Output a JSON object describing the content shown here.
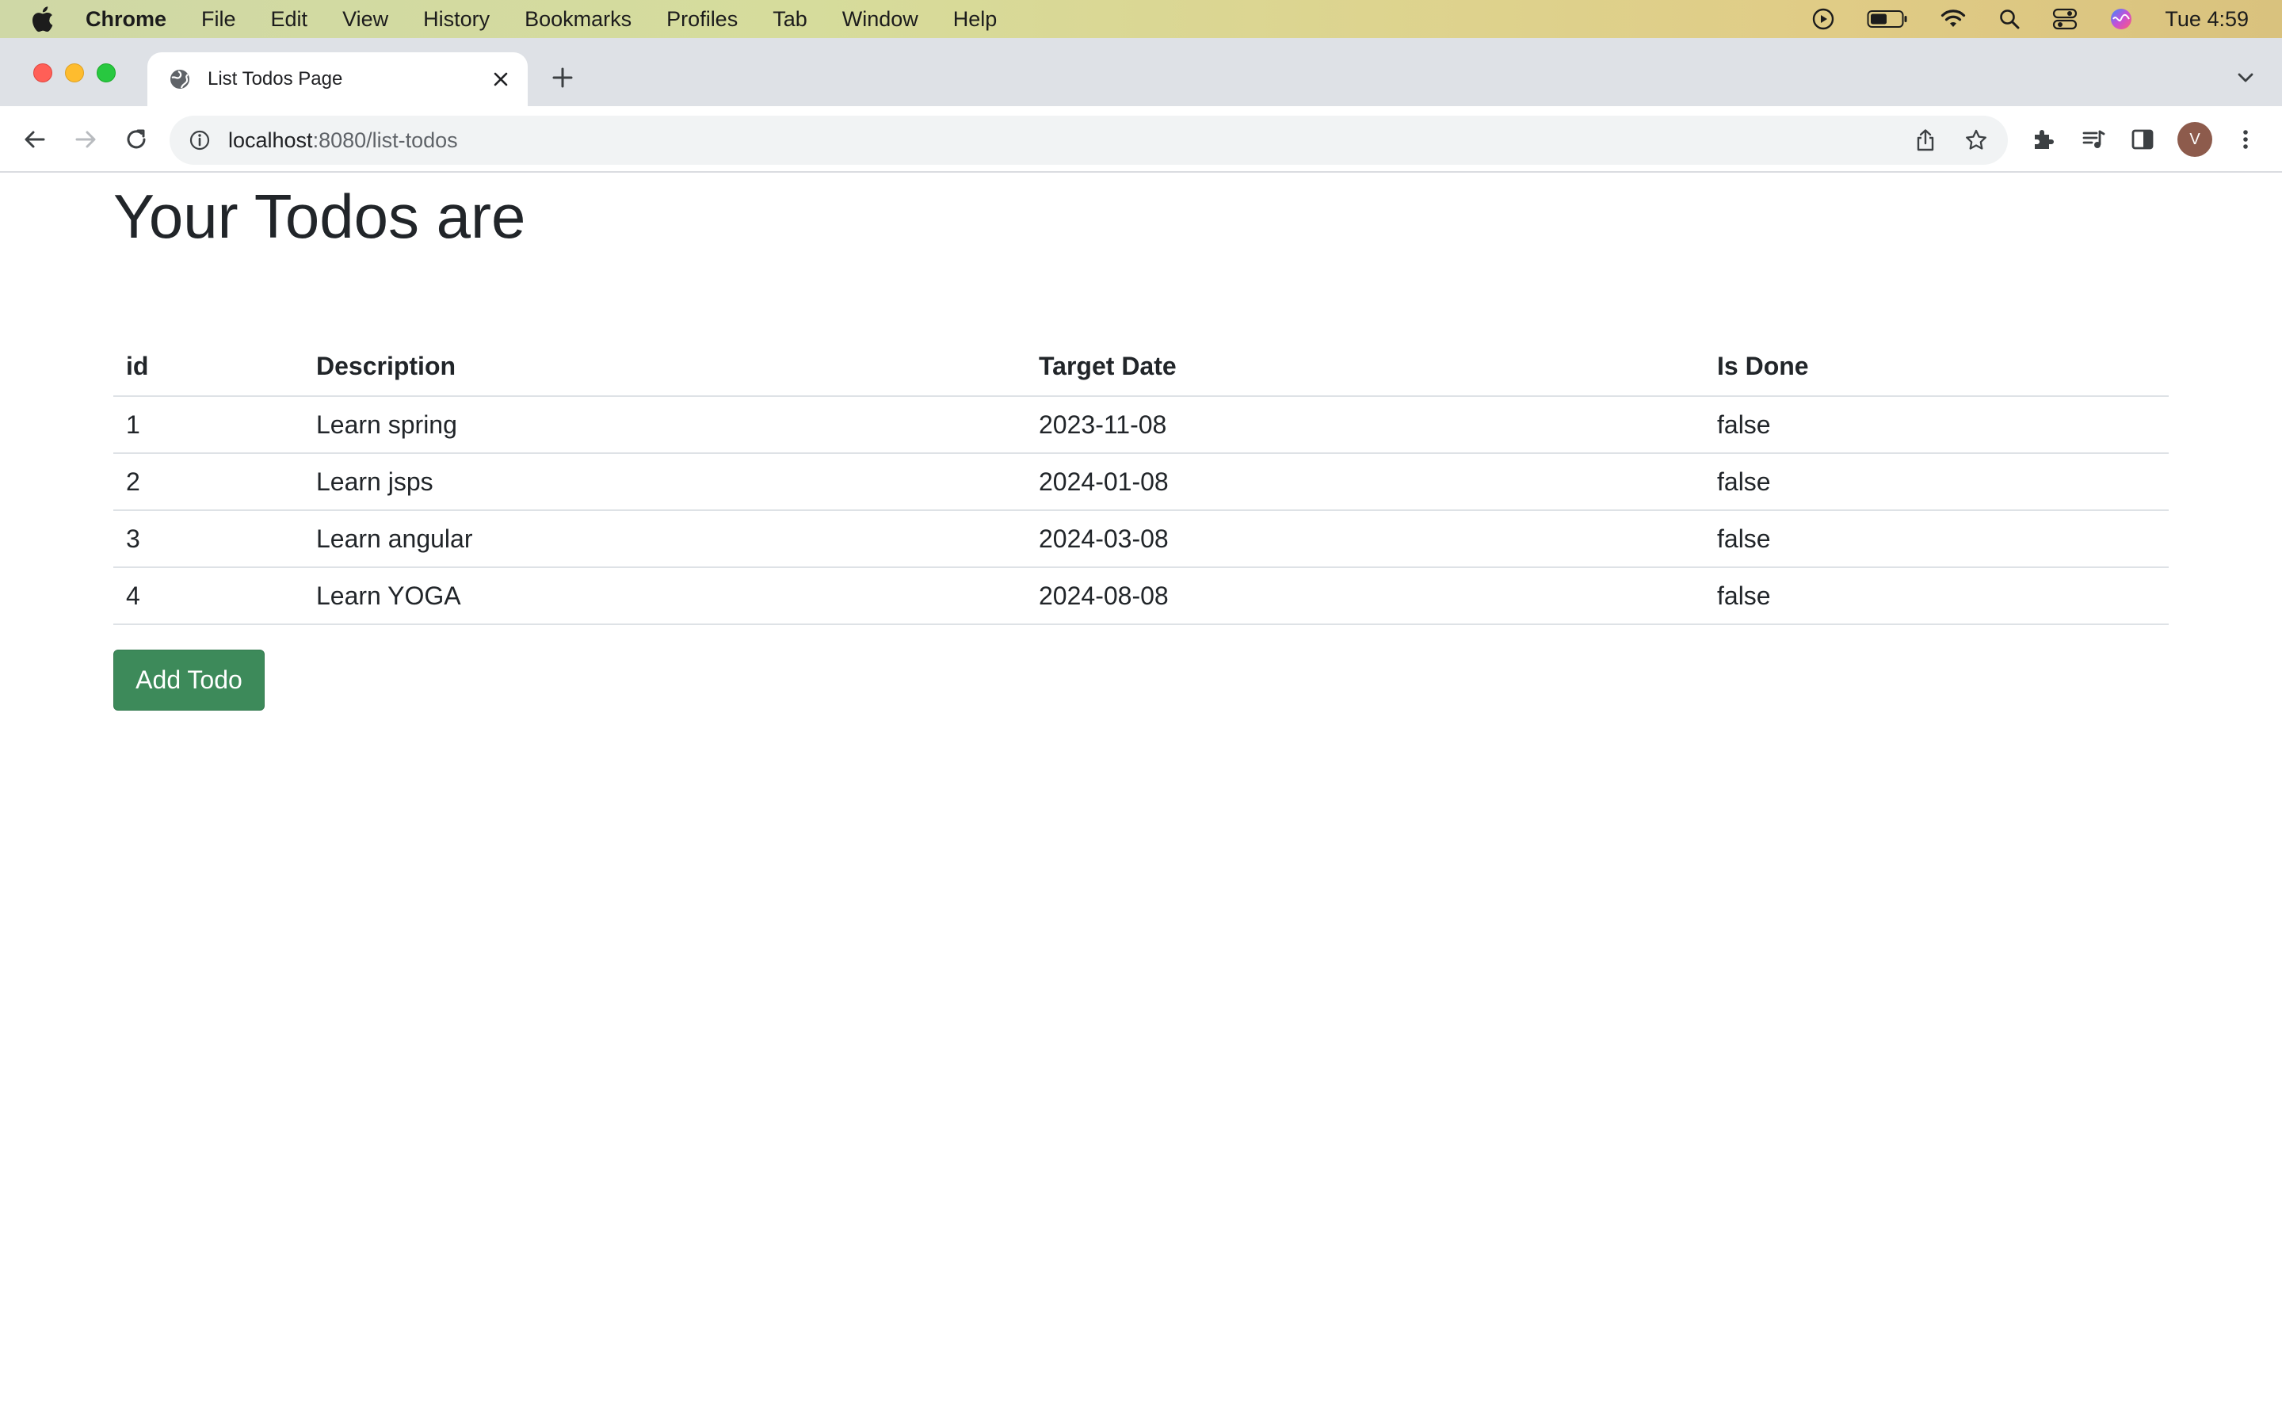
{
  "menubar": {
    "app": "Chrome",
    "items": [
      "File",
      "Edit",
      "View",
      "History",
      "Bookmarks",
      "Profiles",
      "Tab",
      "Window",
      "Help"
    ],
    "clock": "Tue 4:59",
    "icons": [
      "apple-icon",
      "play-circle-icon",
      "battery-icon",
      "wifi-icon",
      "spotlight-icon",
      "control-center-icon",
      "siri-icon"
    ]
  },
  "browser": {
    "tab_title": "List Todos Page",
    "url_host": "localhost",
    "url_path": ":8080/list-todos",
    "avatar_letter": "V"
  },
  "page": {
    "title": "Your Todos are",
    "table": {
      "headers": [
        "id",
        "Description",
        "Target Date",
        "Is Done"
      ],
      "rows": [
        [
          "1",
          "Learn spring",
          "2023-11-08",
          "false"
        ],
        [
          "2",
          "Learn jsps",
          "2024-01-08",
          "false"
        ],
        [
          "3",
          "Learn angular",
          "2024-03-08",
          "false"
        ],
        [
          "4",
          "Learn YOGA",
          "2024-08-08",
          "false"
        ]
      ]
    },
    "add_button": "Add Todo"
  },
  "colors": {
    "button_bg": "#3d8a5a",
    "text": "#212529",
    "row_border": "#dee2e6"
  }
}
